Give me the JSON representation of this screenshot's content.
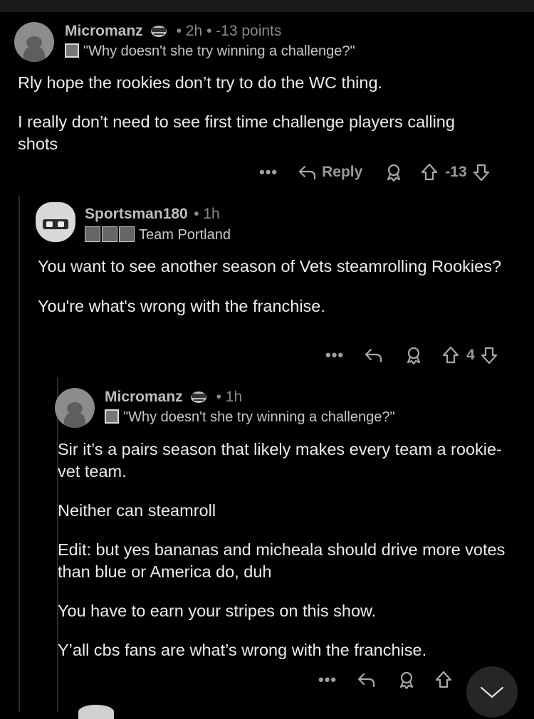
{
  "comments": [
    {
      "username": "Micromanz",
      "meta": "• 2h • -13 points",
      "flair": "\"Why doesn't she try winning a challenge?\"",
      "paragraphs": [
        "Rly hope the rookies don’t try to do the WC thing.",
        "I really don’t need to see first time challenge players calling shots"
      ],
      "actions": {
        "more": "•••",
        "reply": "Reply",
        "score": "-13"
      }
    },
    {
      "username": "Sportsman180",
      "meta": "• 1h",
      "flair": "Team Portland",
      "paragraphs": [
        "You want to see another season of Vets steamrolling Rookies?",
        "You're what's wrong with the franchise."
      ],
      "actions": {
        "more": "•••",
        "score": "4"
      }
    },
    {
      "username": "Micromanz",
      "meta": "• 1h",
      "flair": "\"Why doesn't she try winning a challenge?\"",
      "paragraphs": [
        "Sir it’s a pairs season that likely makes every team a rookie-vet team.",
        "Neither can steamroll",
        "Edit: but yes bananas and micheala should drive more votes than blue or America do, duh",
        "You have to earn your stripes on this show.",
        "Y’all cbs fans are what’s wrong with the franchise."
      ],
      "actions": {
        "more": "•••"
      }
    }
  ],
  "icons": {
    "reply": "reply-arrow-icon",
    "award": "award-icon",
    "upvote": "upvote-arrow-icon",
    "downvote": "downvote-arrow-icon",
    "scroll": "chevron-down-icon"
  }
}
